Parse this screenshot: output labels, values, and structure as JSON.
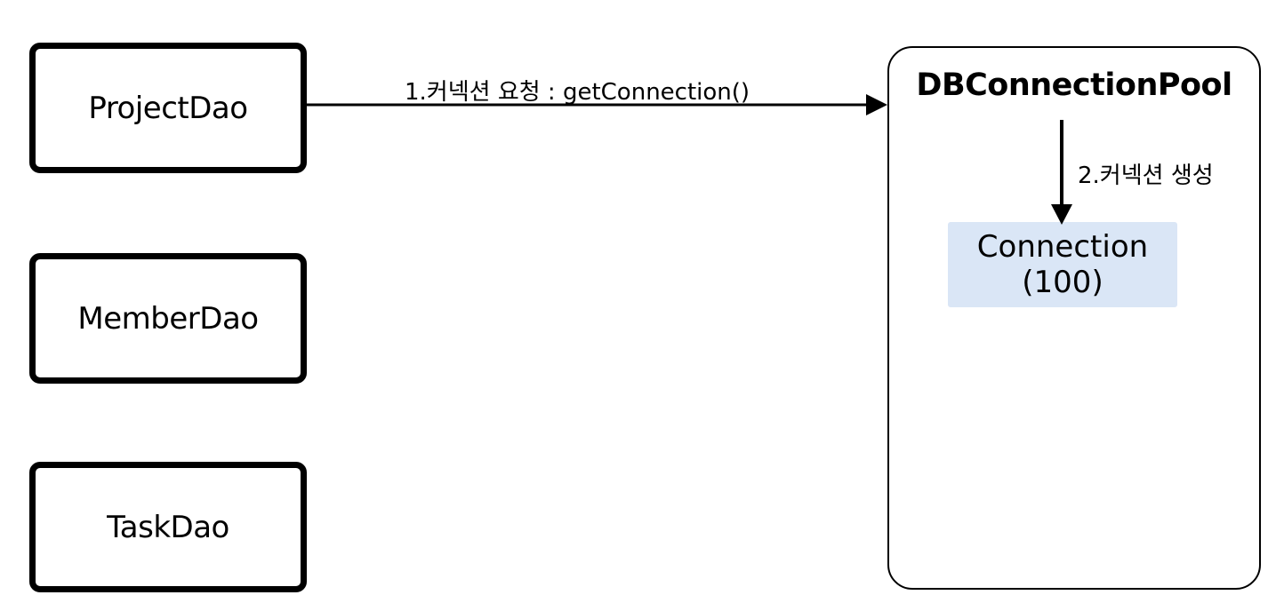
{
  "daos": [
    {
      "label": "ProjectDao"
    },
    {
      "label": "MemberDao"
    },
    {
      "label": "TaskDao"
    }
  ],
  "pool": {
    "title": "DBConnectionPool",
    "connection": {
      "name": "Connection",
      "count": "(100)"
    }
  },
  "edges": {
    "request_label": "1.커넥션 요청 : getConnection()",
    "create_label": "2.커넥션 생성"
  },
  "colors": {
    "connection_fill": "#dae6f6",
    "stroke": "#000000"
  }
}
